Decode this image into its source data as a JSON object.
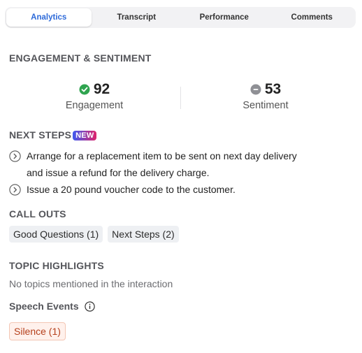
{
  "tabs": [
    {
      "label": "Analytics",
      "active": true
    },
    {
      "label": "Transcript",
      "active": false
    },
    {
      "label": "Performance",
      "active": false
    },
    {
      "label": "Comments",
      "active": false
    }
  ],
  "engagement_section": {
    "title": "ENGAGEMENT & SENTIMENT",
    "engagement": {
      "value": "92",
      "label": "Engagement",
      "icon": "check-circle-icon",
      "color": "#2fa44f"
    },
    "sentiment": {
      "value": "53",
      "label": "Sentiment",
      "icon": "minus-circle-icon",
      "color": "#8f9095"
    }
  },
  "next_steps": {
    "title": "NEXT STEPS",
    "badge": "NEW",
    "items": [
      {
        "line1": "Arrange for a replacement item to be sent on next day delivery",
        "line2": "and issue a refund for the delivery charge."
      },
      {
        "line1": "Issue a 20 pound voucher code to the customer.",
        "line2": ""
      }
    ]
  },
  "call_outs": {
    "title": "CALL OUTS",
    "chips": [
      "Good Questions (1)",
      "Next Steps (2)"
    ]
  },
  "topic_highlights": {
    "title": "TOPIC HIGHLIGHTS",
    "empty_text": "No topics mentioned in the interaction"
  },
  "speech_events": {
    "title": "Speech Events",
    "info_icon": "info-icon",
    "chips": [
      "Silence (1)"
    ],
    "chip_color": "#b5401c"
  }
}
